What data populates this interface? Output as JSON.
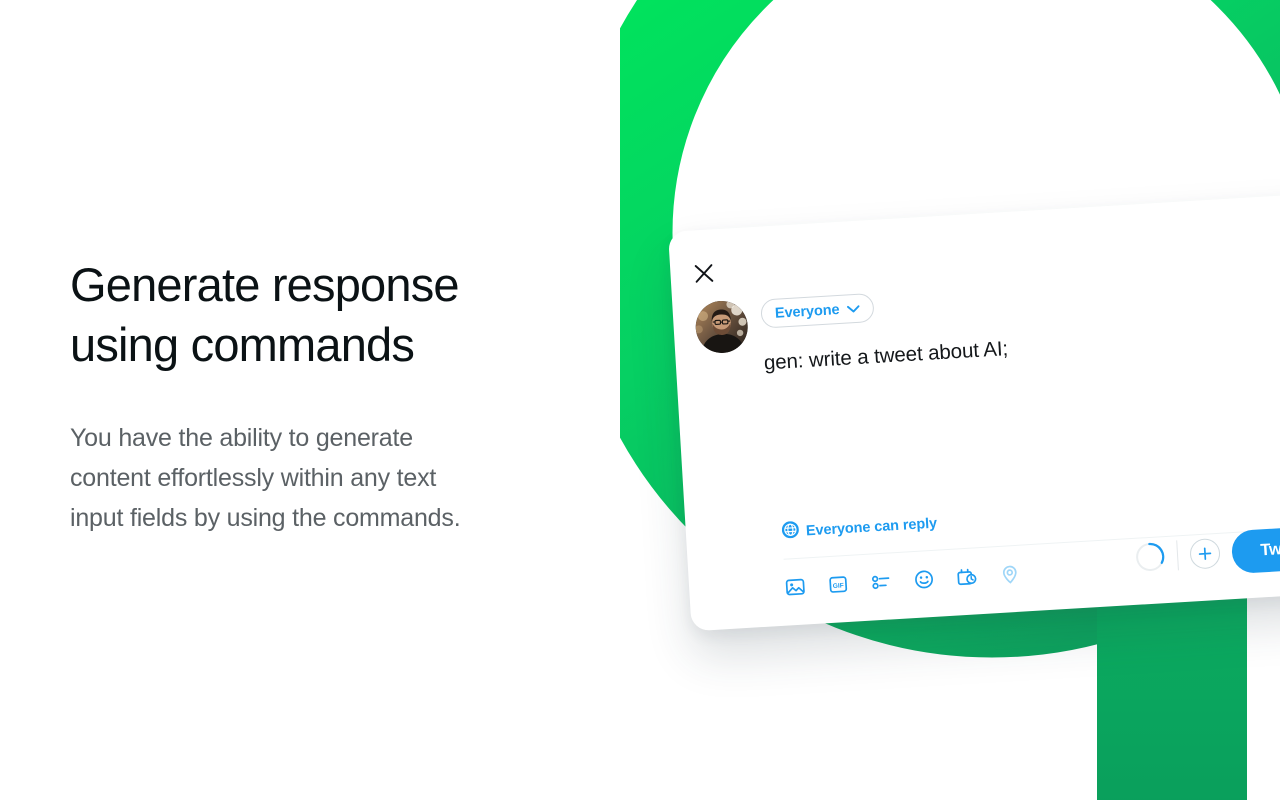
{
  "page": {
    "background_color": "#ffffff",
    "headline": "Generate response\nusing commands",
    "subcopy": "You have the ability to generate\ncontent effortlessly within any text\ninput fields by using the commands."
  },
  "brand": {
    "mark_name": "grammarly-g-mark",
    "green_light": "#00e05d",
    "green_mid": "#07c765",
    "green_dark": "#0ba05f"
  },
  "composer": {
    "close_label": "Close",
    "audience": {
      "label": "Everyone",
      "chevron": "chevron-down-icon"
    },
    "avatar_alt": "User profile photo",
    "tweet_text": "gen: write a tweet about AI;",
    "reply_scope": {
      "icon": "globe-icon",
      "label": "Everyone can reply"
    },
    "accent_color": "#1d9bf0",
    "toolbar": {
      "icons": [
        {
          "name": "image-icon",
          "title": "Media"
        },
        {
          "name": "gif-icon",
          "title": "GIF"
        },
        {
          "name": "poll-icon",
          "title": "Poll"
        },
        {
          "name": "emoji-icon",
          "title": "Emoji"
        },
        {
          "name": "schedule-icon",
          "title": "Schedule"
        },
        {
          "name": "location-icon",
          "title": "Location"
        }
      ],
      "add_label": "+",
      "tweet_label": "Tweet"
    }
  }
}
